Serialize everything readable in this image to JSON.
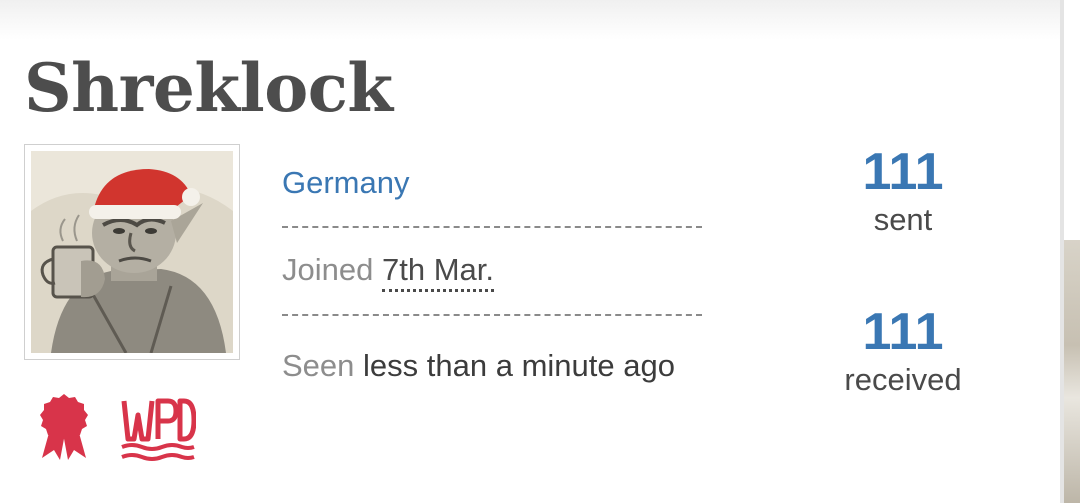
{
  "profile": {
    "username": "Shreklock",
    "country": "Germany",
    "joined_label": "Joined",
    "joined_value": "7th Mar.",
    "seen_label": "Seen",
    "seen_value": "less than a minute ago",
    "avatar_icon": "goblin-santa-hat-portrait"
  },
  "badges": [
    {
      "icon": "award-ribbon-icon",
      "color": "#d8344a"
    },
    {
      "icon": "wpd-logo",
      "text": "WPD",
      "color": "#d8344a"
    }
  ],
  "stats": {
    "sent_count": "111",
    "sent_label": "sent",
    "received_count": "111",
    "received_label": "received"
  },
  "colors": {
    "accent": "#3a77b3",
    "username": "#4d4d4d",
    "badge": "#d8344a",
    "muted": "#8d8d8d"
  }
}
